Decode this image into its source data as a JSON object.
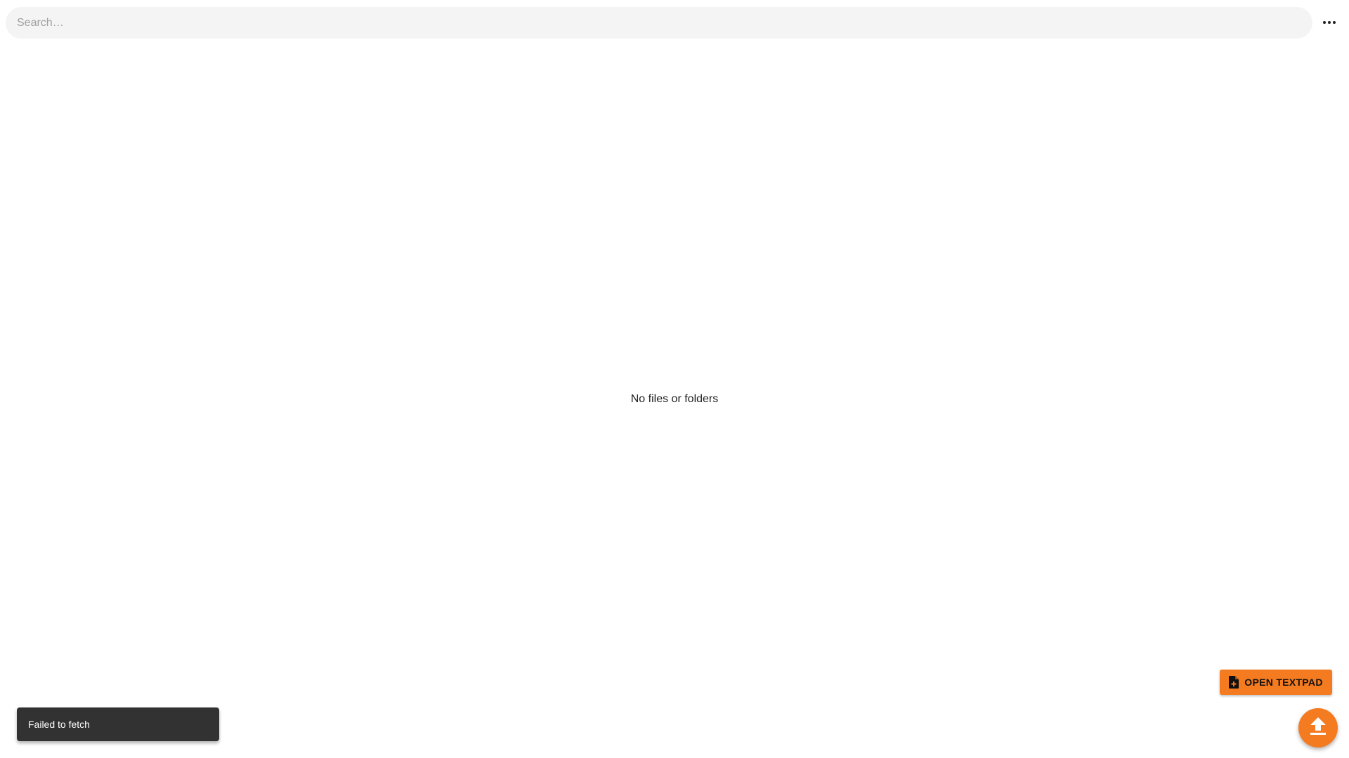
{
  "header": {
    "search": {
      "placeholder": "Search…",
      "value": ""
    },
    "more_menu_icon": "more-horizontal-icon"
  },
  "main": {
    "empty_message": "No files or folders"
  },
  "actions": {
    "open_textpad": {
      "label": "OPEN TEXTPAD",
      "icon": "file-add-icon"
    },
    "upload_fab": {
      "icon": "upload-icon"
    }
  },
  "snackbar": {
    "message": "Failed to fetch"
  },
  "colors": {
    "accent": "#f47b20",
    "search_background": "#f4f4f4",
    "snackbar_background": "#323232"
  }
}
